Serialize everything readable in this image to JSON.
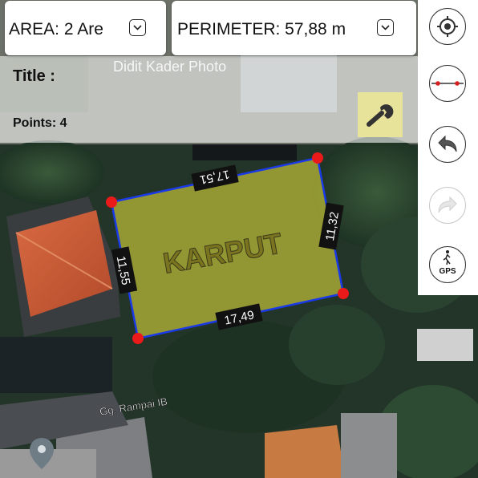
{
  "area": {
    "label": "AREA: 2 Are"
  },
  "perimeter": {
    "label": "PERIMETER: 57,88 m"
  },
  "info": {
    "title_label": "Title :",
    "points_label": "Points: 4"
  },
  "watermark": "Didit Kader Photo",
  "polygon": {
    "name": "KARPUT",
    "side_lengths": [
      "17,51",
      "11,32",
      "17,49",
      "11,55"
    ],
    "fill_color": "#d8d43a",
    "edge_color": "#1a3ae8",
    "vertex_color": "#ea1a1a"
  },
  "map": {
    "street_label": "Gg. Rampai IB"
  },
  "toolbar": {
    "buttons": [
      {
        "name": "locate-icon"
      },
      {
        "name": "measure-line-icon"
      },
      {
        "name": "undo-icon"
      },
      {
        "name": "redo-icon"
      },
      {
        "name": "gps-walk-icon",
        "label": "GPS"
      }
    ]
  }
}
